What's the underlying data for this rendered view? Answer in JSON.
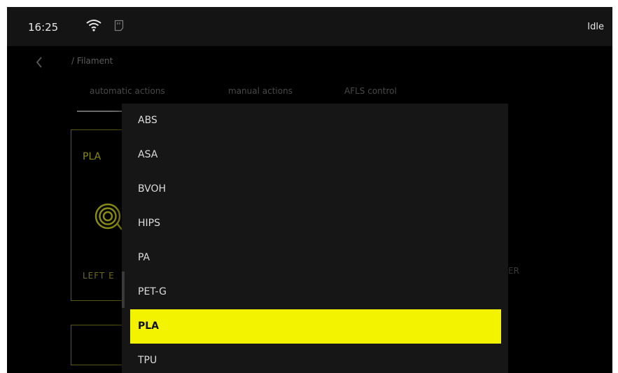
{
  "status_bar": {
    "time": "16:25",
    "printer_state": "Idle"
  },
  "breadcrumb": "/ Filament",
  "tabs": [
    "automatic actions",
    "manual actions",
    "AFLS control"
  ],
  "extruder_card": {
    "material": "PLA",
    "side_label": "LEFT E"
  },
  "right_card_label": "ER",
  "dropdown": {
    "options": [
      "ABS",
      "ASA",
      "BVOH",
      "HIPS",
      "PA",
      "PET-G",
      "PLA",
      "TPU"
    ],
    "selected": "PLA"
  },
  "colors": {
    "accent": "#f3f300",
    "indicator": "#16e06a",
    "card_border": "#5c5a12"
  },
  "icons": [
    "wifi-icon",
    "storage-icon",
    "back-arrow-icon",
    "spool-icon"
  ]
}
